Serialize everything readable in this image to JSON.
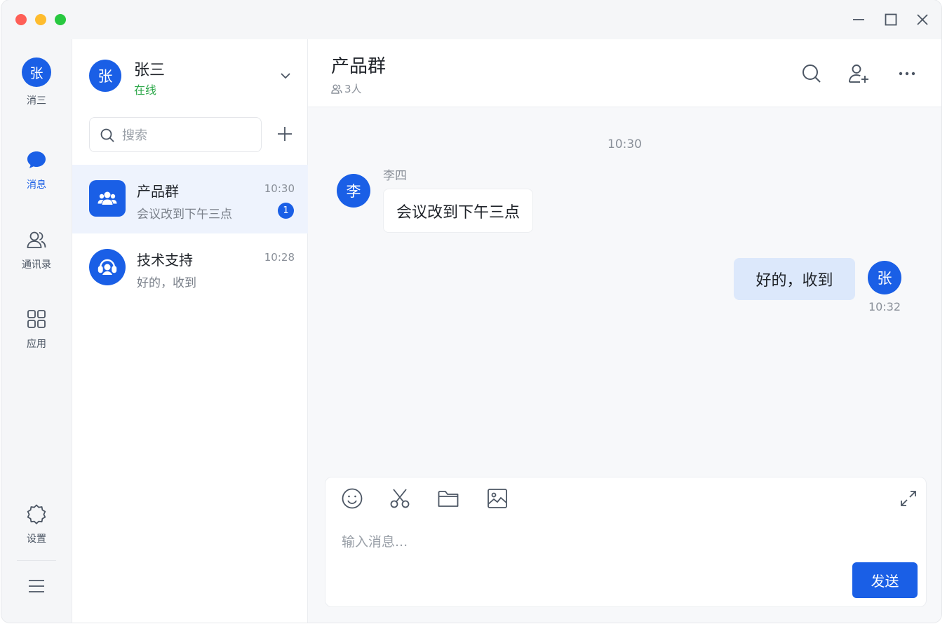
{
  "nav": {
    "avatar_char": "张",
    "avatar_name": "消三",
    "items": [
      {
        "label": "消息",
        "icon": "chat-bubble-icon",
        "active": true
      },
      {
        "label": "通讯录",
        "icon": "contacts-icon",
        "active": false
      },
      {
        "label": "应用",
        "icon": "apps-grid-icon",
        "active": false
      }
    ],
    "settings_label": "设置"
  },
  "profile": {
    "avatar_char": "张",
    "name": "张三",
    "status": "在线"
  },
  "search": {
    "placeholder": "搜索"
  },
  "conversations": [
    {
      "name": "产品群",
      "preview": "会议改到下午三点",
      "time": "10:30",
      "unread": "1",
      "active": true
    },
    {
      "name": "技术支持",
      "preview": "好的，收到",
      "time": "10:28",
      "unread": "",
      "active": false
    }
  ],
  "chat": {
    "title": "产品群",
    "members": "3人",
    "time_divider": "10:30",
    "messages": [
      {
        "sender": "李四",
        "avatar_char": "李",
        "text": "会议改到下午三点",
        "direction": "in"
      },
      {
        "sender": "",
        "avatar_char": "张",
        "text": "好的，收到",
        "time": "10:32",
        "direction": "out"
      }
    ]
  },
  "composer": {
    "placeholder": "输入消息...",
    "send_label": "发送"
  },
  "colors": {
    "accent": "#1a5fe6",
    "online": "#2ea84a",
    "bubble_out": "#dce8fb"
  }
}
